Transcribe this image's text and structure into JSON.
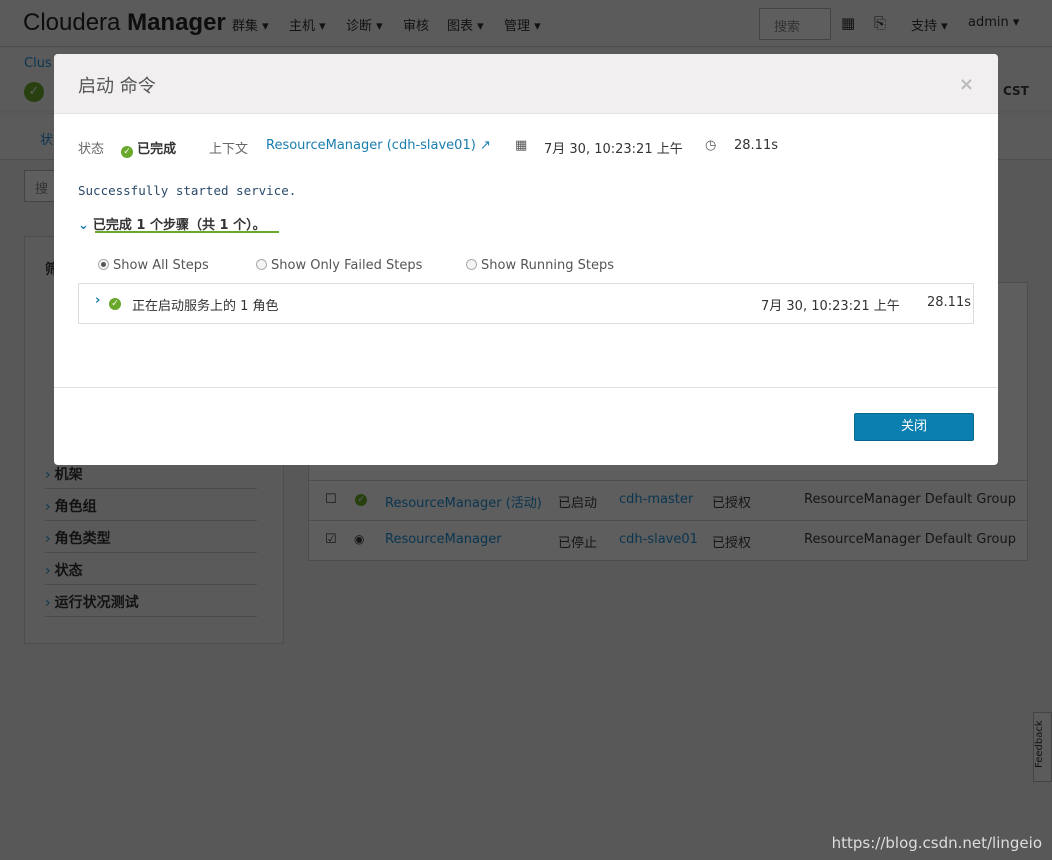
{
  "nav": {
    "logo_light": "Cloudera",
    "logo_bold": "Manager",
    "menus": [
      "群集 ▾",
      "主机 ▾",
      "诊断 ▾",
      "审核",
      "图表 ▾",
      "管理 ▾"
    ],
    "search_placeholder": "搜索",
    "support": "支持 ▾",
    "user": "admin ▾"
  },
  "cluster": {
    "title": "Clus",
    "timezone": "CST",
    "tab": "状",
    "search_placeholder": "搜"
  },
  "filters": {
    "title": "筛",
    "items": [
      "机架",
      "角色组",
      "角色类型",
      "状态",
      "运行状况测试"
    ]
  },
  "table": {
    "rows": [
      {
        "role": "ResourceManager (活动)",
        "state": "已启动",
        "host": "cdh-master",
        "commission": "已授权",
        "group": "ResourceManager Default Group",
        "checked": false,
        "status": "good"
      },
      {
        "role": "ResourceManager",
        "state": "已停止",
        "host": "cdh-slave01",
        "commission": "已授权",
        "group": "ResourceManager Default Group",
        "checked": true,
        "status": "stopped"
      }
    ]
  },
  "modal": {
    "title": "启动 命令",
    "close_x": "×",
    "status_label": "状态",
    "status_value": "已完成",
    "context_label": "上下文",
    "context_value": "ResourceManager (cdh-slave01)",
    "time": "7月 30, 10:23:21 上午",
    "duration": "28.11s",
    "message": "Successfully started service.",
    "steps_summary": "已完成 1 个步骤（共 1 个）。",
    "filters": [
      "Show All Steps",
      "Show Only Failed Steps",
      "Show Running Steps"
    ],
    "selected_filter": "Show All Steps",
    "step": {
      "label": "正在启动服务上的 1 角色",
      "time": "7月 30, 10:23:21 上午",
      "duration": "28.11s"
    },
    "close_button": "关闭"
  },
  "feedback": "Feedback",
  "watermark": "https://blog.csdn.net/lingeio",
  "colors": {
    "primary": "#0b7fb0",
    "success": "#6aa82c",
    "link": "#1a7db0"
  }
}
